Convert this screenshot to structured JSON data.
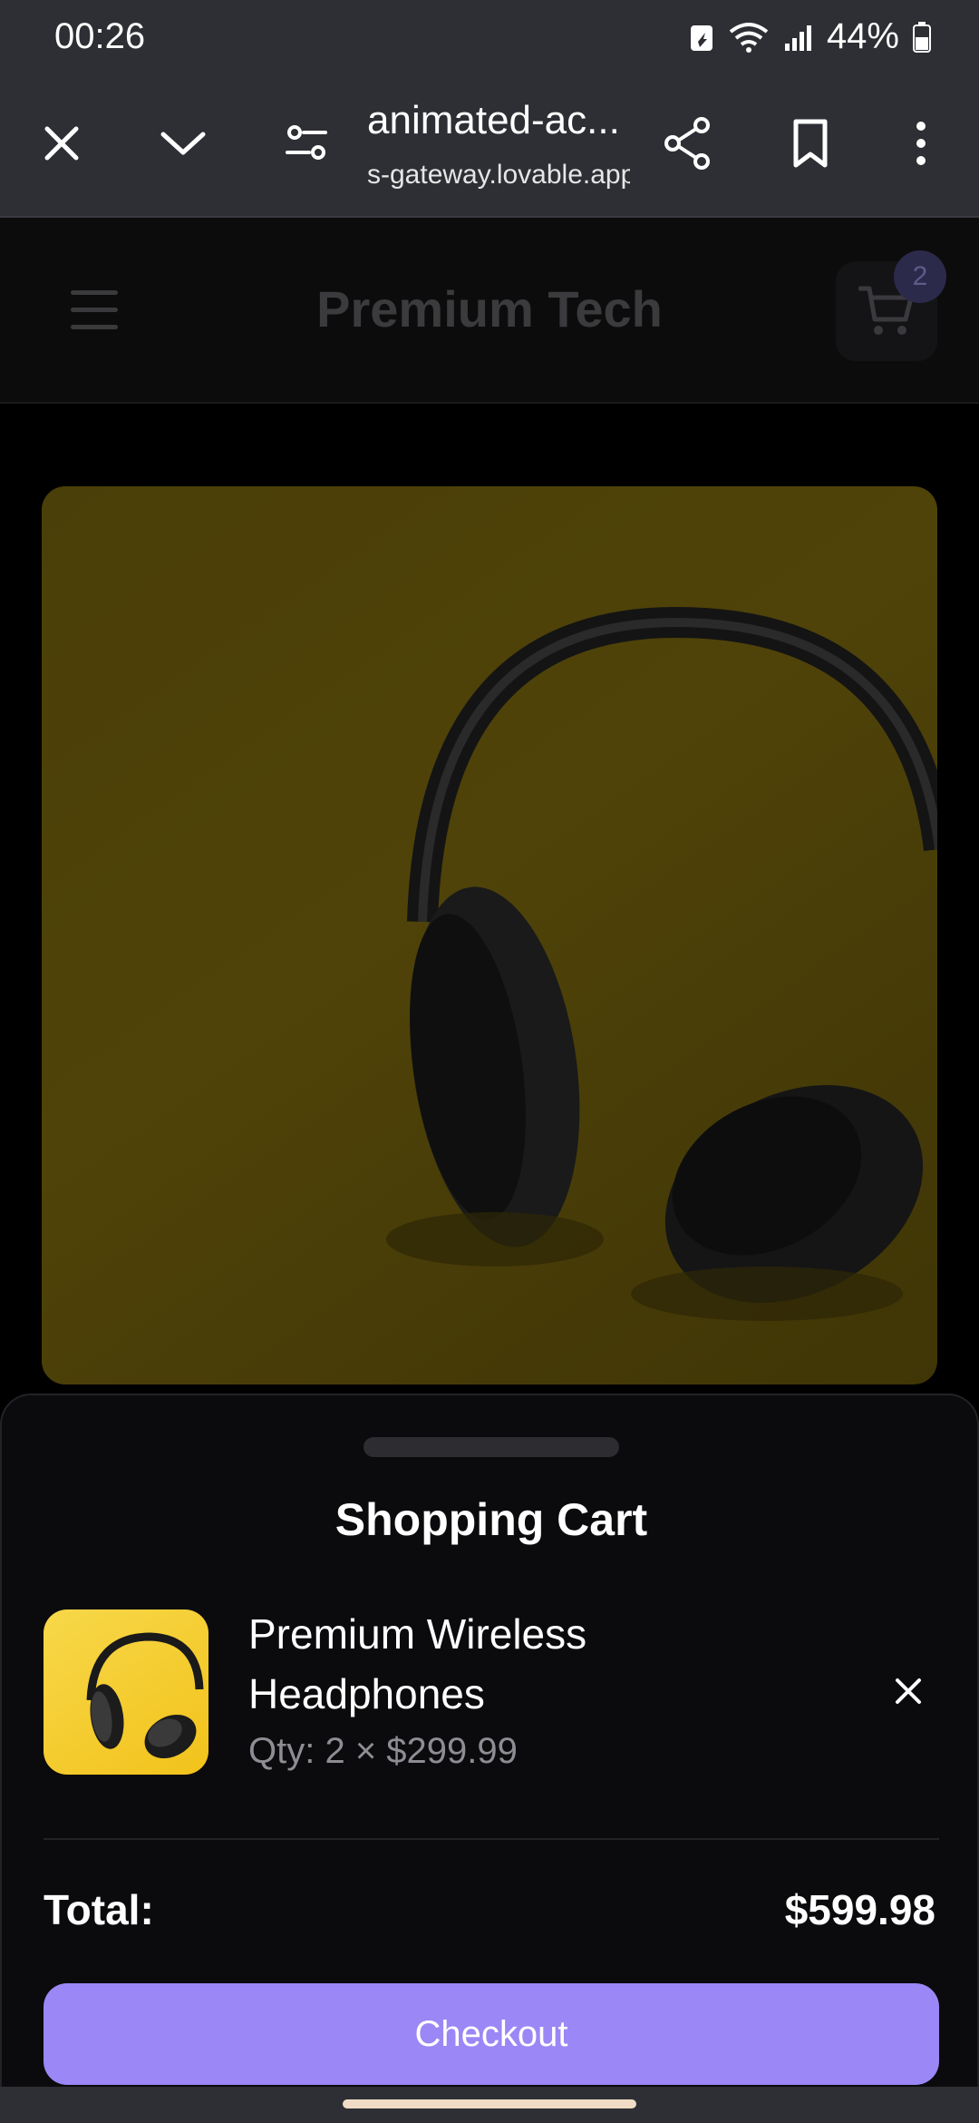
{
  "status_bar": {
    "time": "00:26",
    "battery": "44%"
  },
  "browser": {
    "url_title": "animated-ac...",
    "url_domain": "s-gateway.lovable.app"
  },
  "site": {
    "title": "Premium Tech",
    "cart_count": "2"
  },
  "cart": {
    "title": "Shopping Cart",
    "item_name": "Premium Wireless Headphones",
    "item_qty": "Qty: 2 × $299.99",
    "total_label": "Total:",
    "total_value": "$599.98",
    "checkout_label": "Checkout"
  },
  "colors": {
    "accent": "#9b87f5",
    "sheet_bg": "#0b0b0d",
    "product_yellow": "#f5cd2e"
  }
}
